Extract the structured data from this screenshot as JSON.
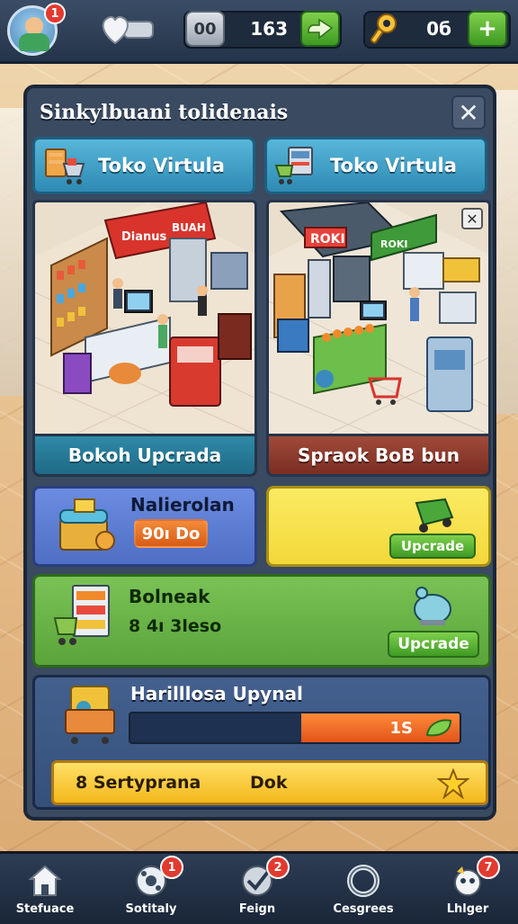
{
  "topbar": {
    "avatar_badge": "1",
    "currency_icon_label": "00",
    "currency_value": "163",
    "key_value": "0б",
    "add_label": "+"
  },
  "panel": {
    "title": "Sinkylbuani tolidenais",
    "close_label": "✕",
    "tabs": [
      {
        "label": "Toko  Virtula",
        "icon": "store-cart-icon"
      },
      {
        "label": "Toko  Virtula",
        "icon": "checkout-cart-icon"
      }
    ],
    "scenes": [
      {
        "footer": "Bokoh  Upcrada",
        "sign_1": "Dianus",
        "sign_2": "BUAH"
      },
      {
        "footer": "Spraok  BoB  bun",
        "sign_1": "ROKI",
        "sign_2": "ROKI"
      }
    ],
    "cards": {
      "materials": {
        "title": "Nalierolan",
        "price": "90ı Do"
      },
      "yellow": {
        "button": "Upcrade"
      },
      "green": {
        "title": "Bolneak",
        "subtitle": "8 4ı 3leso",
        "button": "Upcrade"
      },
      "progress": {
        "title": "Harilllosa  Upynal",
        "value": "1S",
        "fill_fraction": 0.48,
        "bar_left": "8  Sertyprana",
        "bar_center": "Dok"
      }
    }
  },
  "nav": {
    "items": [
      {
        "label": "Stefuace",
        "badge": ""
      },
      {
        "label": "Sotitaly",
        "badge": "1"
      },
      {
        "label": "Feign",
        "badge": "2"
      },
      {
        "label": "Cesgrees",
        "badge": ""
      },
      {
        "label": "Lhlger",
        "badge": "7"
      }
    ]
  },
  "colors": {
    "panel_bg": "#3a4a60",
    "tab_blue": "#2e8ab3",
    "card_blue": "#5a7bd0",
    "card_yellow": "#f6e14a",
    "card_green": "#6db54a",
    "card_navy": "#3b5680",
    "accent_orange": "#e2541a",
    "badge_red": "#e23a2e"
  }
}
